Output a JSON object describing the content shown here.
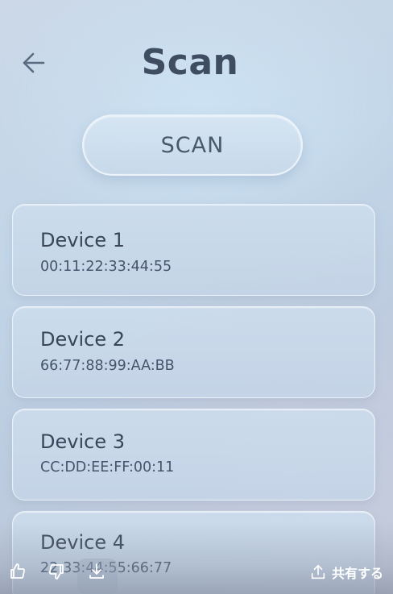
{
  "header": {
    "title": "Scan",
    "back_icon": "arrow-left-icon"
  },
  "scan_button": {
    "label": "SCAN"
  },
  "devices": [
    {
      "name": "Device 1",
      "address": "00:11:22:33:44:55"
    },
    {
      "name": "Device 2",
      "address": "66:77:88:99:AA:BB"
    },
    {
      "name": "Device 3",
      "address": "CC:DD:EE:FF:00:11"
    },
    {
      "name": "Device 4",
      "address": "22:33:44:55:66:77"
    }
  ],
  "toolbar": {
    "like_icon": "thumbs-up-icon",
    "dislike_icon": "thumbs-down-icon",
    "download_icon": "download-icon",
    "share_icon": "share-icon",
    "share_label": "共有する"
  },
  "colors": {
    "title": "#3f4d63",
    "card_background": "#c8d9eb",
    "share_text": "#ffffff"
  }
}
